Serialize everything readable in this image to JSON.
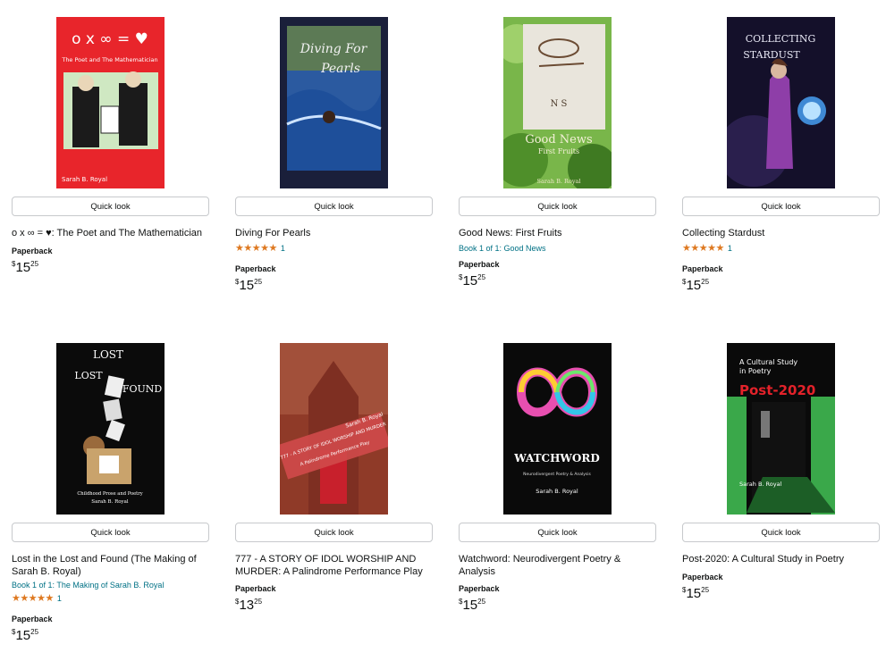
{
  "quick_look_label": "Quick look",
  "products": [
    {
      "title": "o x ∞ = ♥: The Poet and The Mathematician",
      "series": "",
      "rating_stars": "",
      "rating_count": "",
      "format": "Paperback",
      "price": {
        "currency": "$",
        "whole": "15",
        "fraction": "25"
      },
      "cover": {
        "line1": "o x ∞ = ♥",
        "line2": "The Poet and The Mathematician",
        "author": "Sarah B. Royal",
        "bg": "#e8252b"
      }
    },
    {
      "title": "Diving For Pearls",
      "series": "",
      "rating_stars": "★★★★★",
      "rating_count": "1",
      "format": "Paperback",
      "price": {
        "currency": "$",
        "whole": "15",
        "fraction": "25"
      },
      "cover": {
        "line1": "Diving For",
        "line2": "Pearls",
        "author": "",
        "bg": "#1c3b6b"
      }
    },
    {
      "title": "Good News: First Fruits",
      "series": "Book 1 of 1: Good News",
      "rating_stars": "",
      "rating_count": "",
      "format": "Paperback",
      "price": {
        "currency": "$",
        "whole": "15",
        "fraction": "25"
      },
      "cover": {
        "line1": "Good News",
        "line2": "First Fruits",
        "author": "Sarah B. Royal",
        "bg": "#6aa83b"
      }
    },
    {
      "title": "Collecting Stardust",
      "series": "",
      "rating_stars": "★★★★★",
      "rating_count": "1",
      "format": "Paperback",
      "price": {
        "currency": "$",
        "whole": "15",
        "fraction": "25"
      },
      "cover": {
        "line1": "COLLECTING",
        "line2": "STARDUST",
        "author": "",
        "bg": "#1a1430"
      }
    },
    {
      "title": "Lost in the Lost and Found (The Making of Sarah B. Royal)",
      "series": "Book 1 of 1: The Making of Sarah B. Royal",
      "rating_stars": "★★★★★",
      "rating_count": "1",
      "format": "Paperback",
      "price": {
        "currency": "$",
        "whole": "15",
        "fraction": "25"
      },
      "cover": {
        "line1": "Lost in the Lost and Found",
        "line2": "Childhood Prose and Poetry",
        "author": "Sarah B. Royal",
        "bg": "#0b0b0b"
      }
    },
    {
      "title": "777 - A STORY OF IDOL WORSHIP AND MURDER: A Palindrome Performance Play",
      "series": "",
      "rating_stars": "",
      "rating_count": "",
      "format": "Paperback",
      "price": {
        "currency": "$",
        "whole": "13",
        "fraction": "25"
      },
      "cover": {
        "line1": "777 - A STORY OF IDOL WORSHIP AND MURDER",
        "line2": "A Palindrome Performance Play",
        "author": "Sarah B. Royal",
        "bg": "#9c3d2a"
      }
    },
    {
      "title": "Watchword: Neurodivergent Poetry & Analysis",
      "series": "",
      "rating_stars": "",
      "rating_count": "",
      "format": "Paperback",
      "price": {
        "currency": "$",
        "whole": "15",
        "fraction": "25"
      },
      "cover": {
        "line1": "WATCHWORD",
        "line2": "Neurodivergent Poetry & Analysis",
        "author": "Sarah B. Royal",
        "bg": "#0a0a0a"
      }
    },
    {
      "title": "Post-2020: A Cultural Study in Poetry",
      "series": "",
      "rating_stars": "",
      "rating_count": "",
      "format": "Paperback",
      "price": {
        "currency": "$",
        "whole": "15",
        "fraction": "25"
      },
      "cover": {
        "line1": "A Cultural Study in Poetry",
        "line2": "Post-2020",
        "author": "Sarah B. Royal",
        "bg": "#0a0a0a"
      }
    }
  ]
}
